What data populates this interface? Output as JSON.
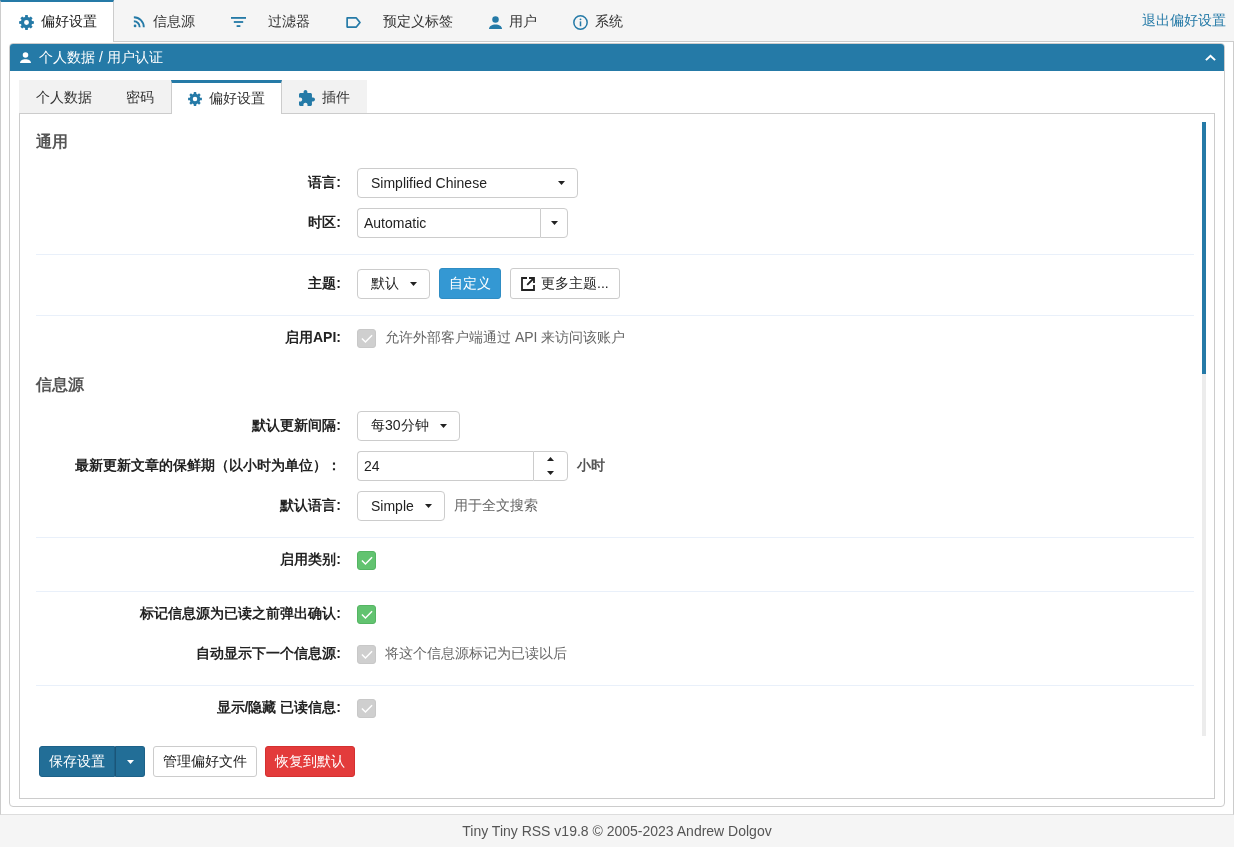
{
  "top_tabs": [
    {
      "label": "偏好设置",
      "selected": true
    },
    {
      "label": "信息源",
      "selected": false
    },
    {
      "label": "过滤器",
      "selected": false
    },
    {
      "label": "预定义标签",
      "selected": false
    },
    {
      "label": "用户",
      "selected": false
    },
    {
      "label": "系统",
      "selected": false
    }
  ],
  "exit_link": "退出偏好设置",
  "panel": {
    "title": "个人数据 / 用户认证",
    "expanded": true
  },
  "sub_tabs": [
    {
      "label": "个人数据",
      "selected": false
    },
    {
      "label": "密码",
      "selected": false
    },
    {
      "label": "偏好设置",
      "selected": true
    },
    {
      "label": "插件",
      "selected": false
    }
  ],
  "sections": [
    {
      "title": "通用",
      "groups": [
        {
          "rows": [
            {
              "label": "语言:",
              "controls": [
                {
                  "kind": "select",
                  "value": "Simplified Chinese"
                }
              ]
            },
            {
              "label": "时区:",
              "controls": [
                {
                  "kind": "combobox",
                  "value": "Automatic"
                }
              ]
            }
          ]
        },
        {
          "rows": [
            {
              "label": "主题:",
              "controls": [
                {
                  "kind": "dropdown",
                  "value": "默认"
                },
                {
                  "kind": "button",
                  "label": "自定义"
                },
                {
                  "kind": "external",
                  "label": "更多主题..."
                }
              ]
            }
          ]
        },
        {
          "rows": [
            {
              "label": "启用API:",
              "controls": [
                {
                  "kind": "checkbox",
                  "checked": true,
                  "disabled": true
                },
                {
                  "kind": "hint",
                  "text": "允许外部客户端通过 API 来访问该账户"
                }
              ]
            }
          ]
        }
      ]
    },
    {
      "title": "信息源",
      "groups": [
        {
          "rows": [
            {
              "label": "默认更新间隔:",
              "controls": [
                {
                  "kind": "dropdown",
                  "value": "每30分钟"
                }
              ]
            },
            {
              "label": "最新更新文章的保鲜期（以小时为单位）：",
              "controls": [
                {
                  "kind": "number",
                  "value": "24"
                },
                {
                  "kind": "unit",
                  "text": "小时"
                }
              ]
            },
            {
              "label": "默认语言:",
              "controls": [
                {
                  "kind": "dropdown",
                  "value": "Simple"
                },
                {
                  "kind": "hint",
                  "text": "用于全文搜索"
                }
              ]
            }
          ]
        },
        {
          "rows": [
            {
              "label": "启用类别:",
              "controls": [
                {
                  "kind": "checkbox",
                  "checked": true,
                  "disabled": false
                }
              ]
            }
          ]
        },
        {
          "rows": [
            {
              "label": "标记信息源为已读之前弹出确认:",
              "controls": [
                {
                  "kind": "checkbox",
                  "checked": true,
                  "disabled": false
                }
              ]
            },
            {
              "label": "自动显示下一个信息源:",
              "controls": [
                {
                  "kind": "checkbox",
                  "checked": true,
                  "disabled": true
                },
                {
                  "kind": "hint",
                  "text": "将这个信息源标记为已读以后"
                }
              ]
            }
          ]
        },
        {
          "rows": [
            {
              "label": "显示/隐藏 已读信息:",
              "controls": [
                {
                  "kind": "checkbox",
                  "checked": true,
                  "disabled": true
                }
              ]
            }
          ]
        }
      ]
    }
  ],
  "actions": [
    {
      "label": "保存设置",
      "kind": "split"
    },
    {
      "label": "管理偏好文件",
      "kind": "plain"
    },
    {
      "label": "恢复到默认",
      "kind": "danger"
    }
  ],
  "footer": "Tiny Tiny RSS v19.8 © 2005-2023 Andrew Dolgov"
}
